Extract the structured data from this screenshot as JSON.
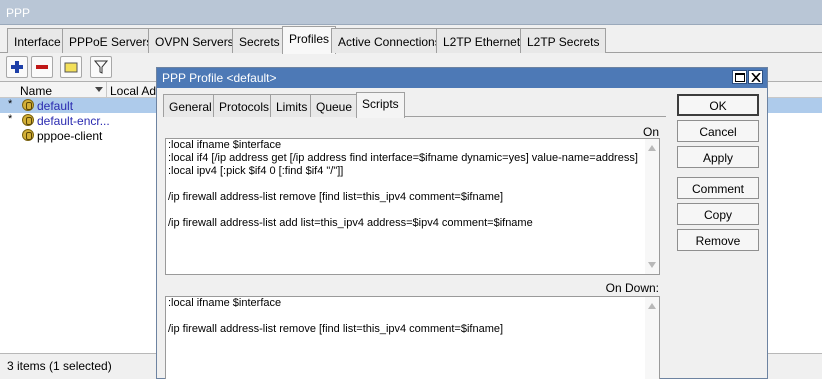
{
  "outer": {
    "title": "PPP",
    "tabs": [
      "Interface",
      "PPPoE Servers",
      "OVPN Servers",
      "Secrets",
      "Profiles",
      "Active Connections",
      "L2TP Ethernet",
      "L2TP Secrets"
    ],
    "active_tab": "Profiles"
  },
  "toolbar": {
    "add_icon": "plus-icon",
    "remove_icon": "minus-icon",
    "comment_icon": "note-icon",
    "filter_icon": "filter-icon"
  },
  "list": {
    "columns": {
      "name": "Name",
      "local_address": "Local Ad"
    },
    "rows": [
      {
        "mark": "*",
        "name": "default"
      },
      {
        "mark": "*",
        "name": "default-encr..."
      },
      {
        "mark": "",
        "name": "pppoe-client"
      }
    ],
    "status": "3 items (1 selected)"
  },
  "dialog": {
    "title": "PPP Profile <default>",
    "tabs": [
      "General",
      "Protocols",
      "Limits",
      "Queue",
      "Scripts"
    ],
    "active_tab": "Scripts",
    "on_up_label": "On Up:",
    "on_up_script": ":local ifname $interface\n:local if4 [/ip address get [/ip address find interface=$ifname dynamic=yes] value-name=address]\n:local ipv4 [:pick $if4 0 [:find $if4 \"/\"]]\n\n/ip firewall address-list remove [find list=this_ipv4 comment=$ifname]\n\n/ip firewall address-list add list=this_ipv4 address=$ipv4 comment=$ifname",
    "on_down_label": "On Down:",
    "on_down_script": ":local ifname $interface\n\n/ip firewall address-list remove [find list=this_ipv4 comment=$ifname]",
    "buttons": {
      "ok": "OK",
      "cancel": "Cancel",
      "apply": "Apply",
      "comment": "Comment",
      "copy": "Copy",
      "remove": "Remove"
    }
  }
}
